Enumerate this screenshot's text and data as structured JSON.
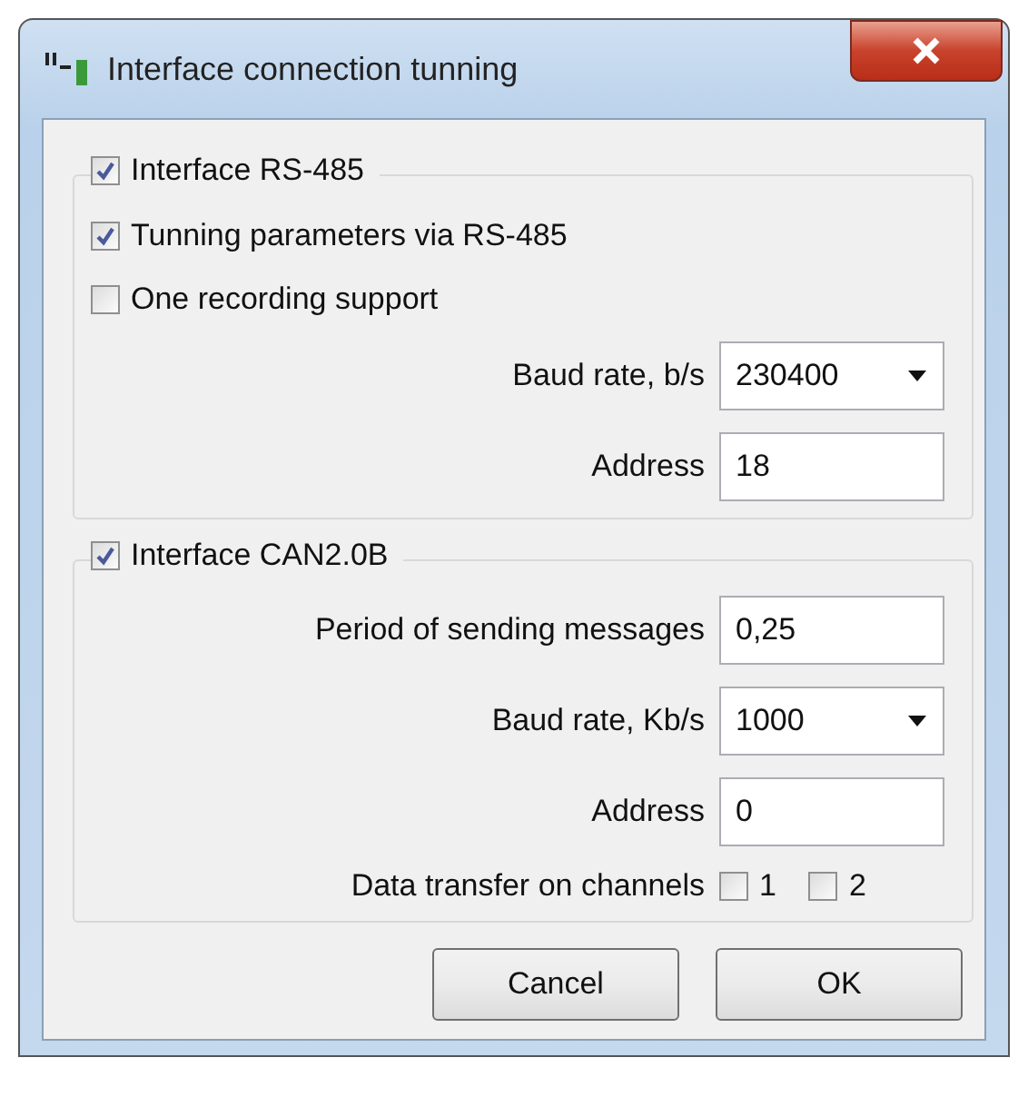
{
  "window": {
    "title": "Interface connection tunning"
  },
  "groups": [
    {
      "header": {
        "label": "Interface RS-485",
        "checked": true
      },
      "options": [
        {
          "label": "Tunning parameters via RS-485",
          "checked": true
        },
        {
          "label": "One recording support",
          "checked": false
        }
      ],
      "fields": [
        {
          "kind": "dropdown",
          "label": "Baud rate, b/s",
          "value": "230400"
        },
        {
          "kind": "text",
          "label": "Address",
          "value": "18"
        }
      ]
    },
    {
      "header": {
        "label": "Interface CAN2.0B",
        "checked": true
      },
      "fields": [
        {
          "kind": "text",
          "label": "Period of sending messages",
          "value": "0,25"
        },
        {
          "kind": "dropdown",
          "label": "Baud rate, Kb/s",
          "value": "1000"
        },
        {
          "kind": "text",
          "label": "Address",
          "value": "0"
        },
        {
          "kind": "channels",
          "label": "Data transfer on channels",
          "channels": [
            {
              "label": "1",
              "checked": false
            },
            {
              "label": "2",
              "checked": false
            }
          ]
        }
      ]
    }
  ],
  "buttons": [
    "Cancel",
    "OK"
  ]
}
